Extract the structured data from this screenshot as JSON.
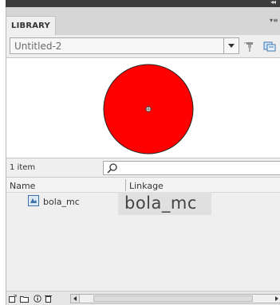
{
  "panel": {
    "tab_label": "LIBRARY",
    "collapse_glyph": "◂◂",
    "menu_glyph": "▾≡"
  },
  "document_select": {
    "value": "Untitled-2"
  },
  "preview": {
    "symbol_color": "#ff0000",
    "outline_color": "#000000"
  },
  "item_count": "1 item",
  "columns": {
    "name": "Name",
    "linkage": "Linkage"
  },
  "items": [
    {
      "name": "bola_mc",
      "icon": "movieclip-icon"
    }
  ],
  "tooltip": "bola_mc",
  "icons": {
    "pin": "pin-library-icon",
    "new_library": "new-library-panel-icon",
    "search": "search-icon",
    "new_symbol": "new-symbol-icon",
    "new_folder": "new-folder-icon",
    "properties": "properties-icon",
    "delete": "delete-icon"
  }
}
